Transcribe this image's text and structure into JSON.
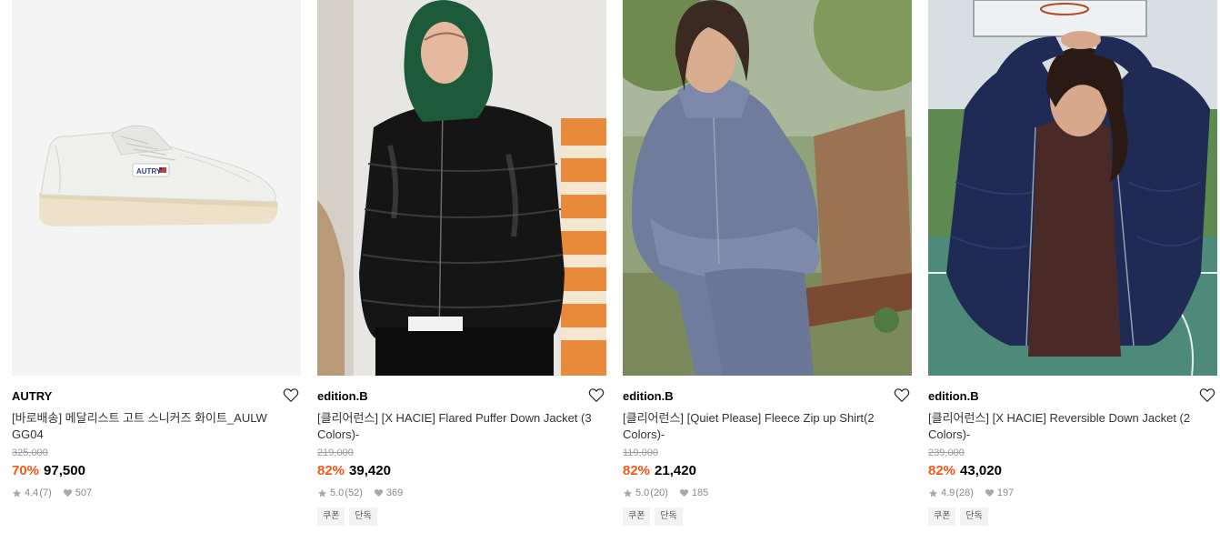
{
  "products": [
    {
      "brand": "AUTRY",
      "name": "[바로배송] 메달리스트 고트 스니커즈 화이트_AULW GG04",
      "original_price": "325,000",
      "discount": "70%",
      "price": "97,500",
      "rating": "4.4",
      "review_count": "(7)",
      "likes": "507",
      "tags": [],
      "image": "white-sneaker"
    },
    {
      "brand": "edition.B",
      "name": "[클리어런스] [X HACIE] Flared Puffer Down Jacket (3 Colors)-",
      "original_price": "219,000",
      "discount": "82%",
      "price": "39,420",
      "rating": "5.0",
      "review_count": "(52)",
      "likes": "369",
      "tags": [
        "쿠폰",
        "단독"
      ],
      "image": "black-puffer-jacket"
    },
    {
      "brand": "edition.B",
      "name": "[클리어런스] [Quiet Please] Fleece Zip up Shirt(2 Colors)-",
      "original_price": "119,000",
      "discount": "82%",
      "price": "21,420",
      "rating": "5.0",
      "review_count": "(20)",
      "likes": "185",
      "tags": [
        "쿠폰",
        "단독"
      ],
      "image": "blue-fleece"
    },
    {
      "brand": "edition.B",
      "name": "[클리어런스] [X HACIE] Reversible Down Jacket (2 Colors)-",
      "original_price": "239,000",
      "discount": "82%",
      "price": "43,020",
      "rating": "4.9",
      "review_count": "(28)",
      "likes": "197",
      "tags": [
        "쿠폰",
        "단독"
      ],
      "image": "navy-down-jacket"
    }
  ],
  "colors": {
    "discount": "#ef5a17",
    "tag_bg": "#f2f2f2"
  }
}
